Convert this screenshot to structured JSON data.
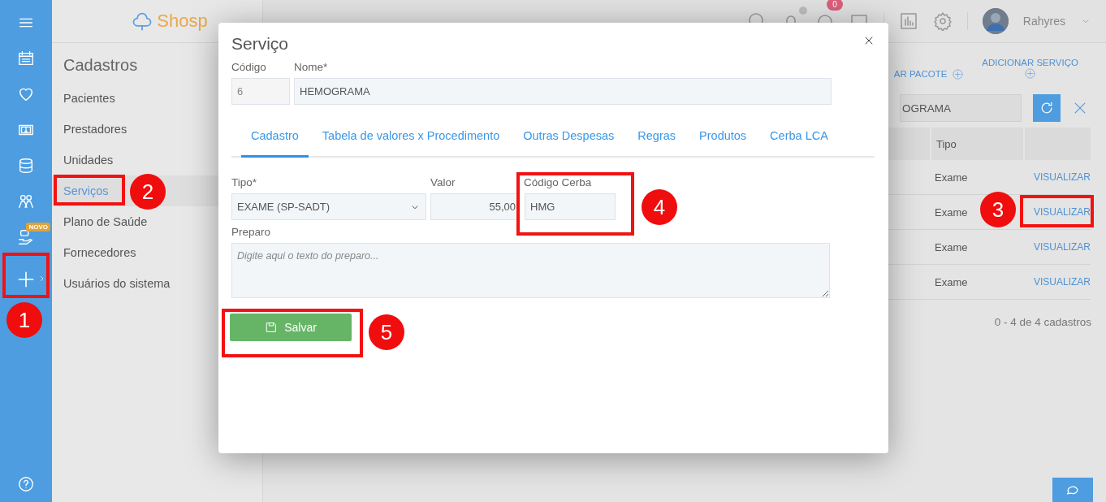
{
  "rail": {
    "badge": "NOVO"
  },
  "header": {
    "logo": "Shosp",
    "notification_badge": "0",
    "user_name": "Rahyres"
  },
  "sidebar": {
    "title": "Cadastros",
    "items": [
      {
        "label": "Pacientes",
        "selected": false
      },
      {
        "label": "Prestadores",
        "selected": false
      },
      {
        "label": "Unidades",
        "selected": false
      },
      {
        "label": "Serviços",
        "selected": true
      },
      {
        "label": "Plano de Saúde",
        "selected": false
      },
      {
        "label": "Fornecedores",
        "selected": false
      },
      {
        "label": "Usuários do sistema",
        "selected": false
      }
    ]
  },
  "main": {
    "actions": [
      {
        "label": "AR PACOTE"
      },
      {
        "label": "ADICIONAR SERVIÇO"
      }
    ],
    "search": {
      "value": "OGRAMA"
    },
    "table": {
      "columns": [
        "Tipo"
      ],
      "rows": [
        {
          "tipo": "Exame",
          "action": "VISUALIZAR"
        },
        {
          "tipo": "Exame",
          "action": "VISUALIZAR"
        },
        {
          "tipo": "Exame",
          "action": "VISUALIZAR"
        },
        {
          "tipo": "Exame",
          "action": "VISUALIZAR"
        }
      ]
    },
    "footer": "0 - 4 de 4 cadastros"
  },
  "modal": {
    "title": "Serviço",
    "codigo": {
      "label": "Código",
      "value": "6"
    },
    "nome": {
      "label": "Nome*",
      "value": "HEMOGRAMA"
    },
    "tabs": [
      {
        "label": "Cadastro",
        "selected": true
      },
      {
        "label": "Tabela de valores x Procedimento",
        "selected": false
      },
      {
        "label": "Outras Despesas",
        "selected": false
      },
      {
        "label": "Regras",
        "selected": false
      },
      {
        "label": "Produtos",
        "selected": false
      },
      {
        "label": "Cerba LCA",
        "selected": false
      }
    ],
    "tipo": {
      "label": "Tipo*",
      "value": "EXAME (SP-SADT)"
    },
    "valor": {
      "label": "Valor",
      "value": "55,00"
    },
    "codigo_cerba": {
      "label": "Código Cerba",
      "value": "HMG"
    },
    "preparo": {
      "label": "Preparo",
      "placeholder": "Digite aqui o texto do preparo..."
    },
    "save_button": "Salvar"
  },
  "annotations": [
    {
      "number": "1"
    },
    {
      "number": "2"
    },
    {
      "number": "3"
    },
    {
      "number": "4"
    },
    {
      "number": "5"
    }
  ]
}
